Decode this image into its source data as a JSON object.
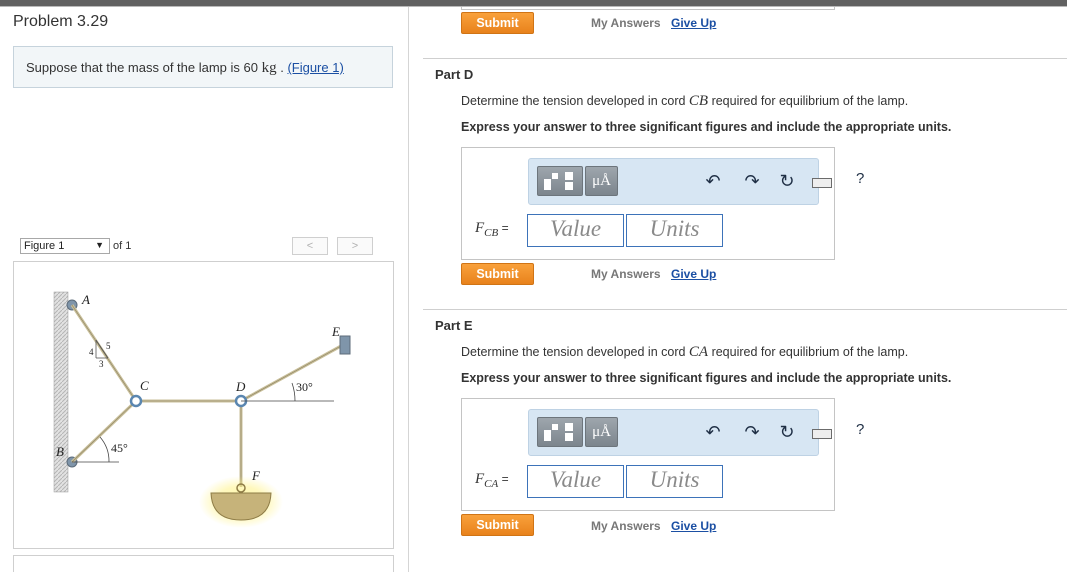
{
  "problem": {
    "title": "Problem 3.29",
    "prompt_prefix": "Suppose that the mass of the lamp is 60 ",
    "prompt_unit": "kg",
    "prompt_sep": " . ",
    "figure_link": "(Figure 1)"
  },
  "figure": {
    "selected": "Figure 1",
    "of_text": "of 1",
    "prev": "<",
    "next": ">",
    "labels": {
      "A": "A",
      "B": "B",
      "C": "C",
      "D": "D",
      "E": "E",
      "F": "F",
      "n4": "4",
      "n5": "5",
      "n3": "3",
      "angle30": "30°",
      "angle45": "45°"
    }
  },
  "actions": {
    "submit": "Submit",
    "my_answers": "My Answers",
    "give_up": "Give Up"
  },
  "toolbar": {
    "units_symbol": "μÅ",
    "help": "?",
    "icons": [
      "templates-icon",
      "units-icon",
      "undo-icon",
      "redo-icon",
      "reset-icon",
      "keyboard-icon",
      "help-icon"
    ]
  },
  "part_d": {
    "title": "Part D",
    "question_prefix": "Determine the tension developed in cord ",
    "cord": "CB",
    "question_suffix": " required for equilibrium of the lamp.",
    "instruction": "Express your answer to three significant figures and include the appropriate units.",
    "var_main": "F",
    "var_sub": "CB",
    "equals": " =",
    "value_placeholder": "Value",
    "units_placeholder": "Units"
  },
  "part_e": {
    "title": "Part E",
    "question_prefix": "Determine the tension developed in cord ",
    "cord": "CA",
    "question_suffix": " required for equilibrium of the lamp.",
    "instruction": "Express your answer to three significant figures and include the appropriate units.",
    "var_main": "F",
    "var_sub": "CA",
    "equals": " =",
    "value_placeholder": "Value",
    "units_placeholder": "Units"
  },
  "colors": {
    "submit": "#f29a2e",
    "link": "#1b4fa3",
    "toolbar_bg": "#d7e6f3",
    "field_border": "#3d73b9"
  }
}
